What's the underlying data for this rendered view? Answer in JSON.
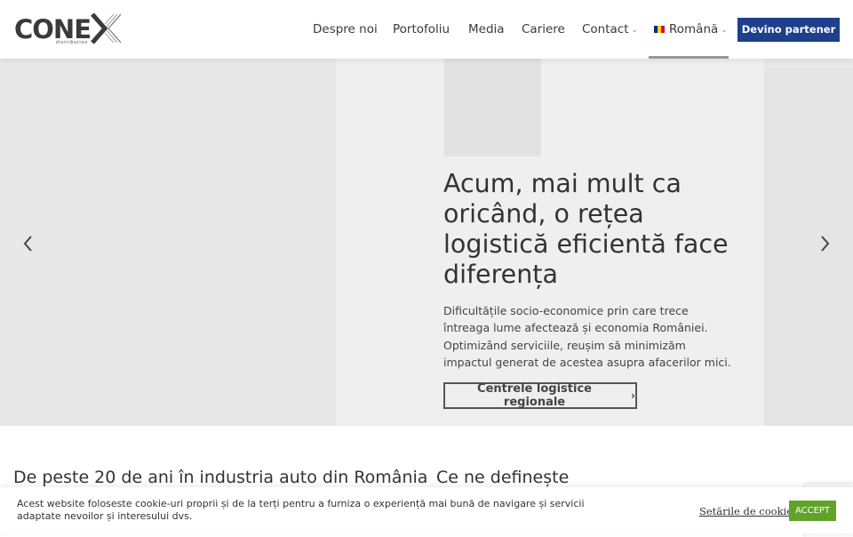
{
  "header": {
    "logo_text": "CONE",
    "logo_sub": "distribution",
    "nav": {
      "about": "Despre noi",
      "portfolio": "Portofoliu",
      "media": "Media",
      "careers": "Cariere",
      "contact": "Contact",
      "language": "Română"
    },
    "partner_button": "Devino partener"
  },
  "hero": {
    "title": "Acum, mai mult ca oricând, o rețea logistică eficientă face diferența",
    "description": "Dificultățile socio-economice prin care trece întreaga lume afectează și economia României. Optimizând serviciile, reușim să minimizăm impactul generat de acestea asupra afacerilor mici.",
    "cta": "Centrele logistice regionale"
  },
  "sections": {
    "left_heading": "De peste 20 de ani în industria auto din România",
    "right_heading": "Ce ne definește"
  },
  "cookie": {
    "text": "Acest website foloseste cookie-uri proprii și de la terți pentru a furniza o experiență mai bună de navigare și servicii adaptate nevoilor și interesului dvs.",
    "settings": "Setările de cookie",
    "accept": "ACCEPT"
  },
  "colors": {
    "brand_blue": "#1d3f8c",
    "accept_green": "#61a229",
    "hero_bg": "#e8e8e8"
  },
  "icons": {
    "prev": "chevron-left-icon",
    "next": "chevron-right-icon",
    "dropdown": "chevron-down-icon",
    "flag": "romania-flag-icon"
  }
}
